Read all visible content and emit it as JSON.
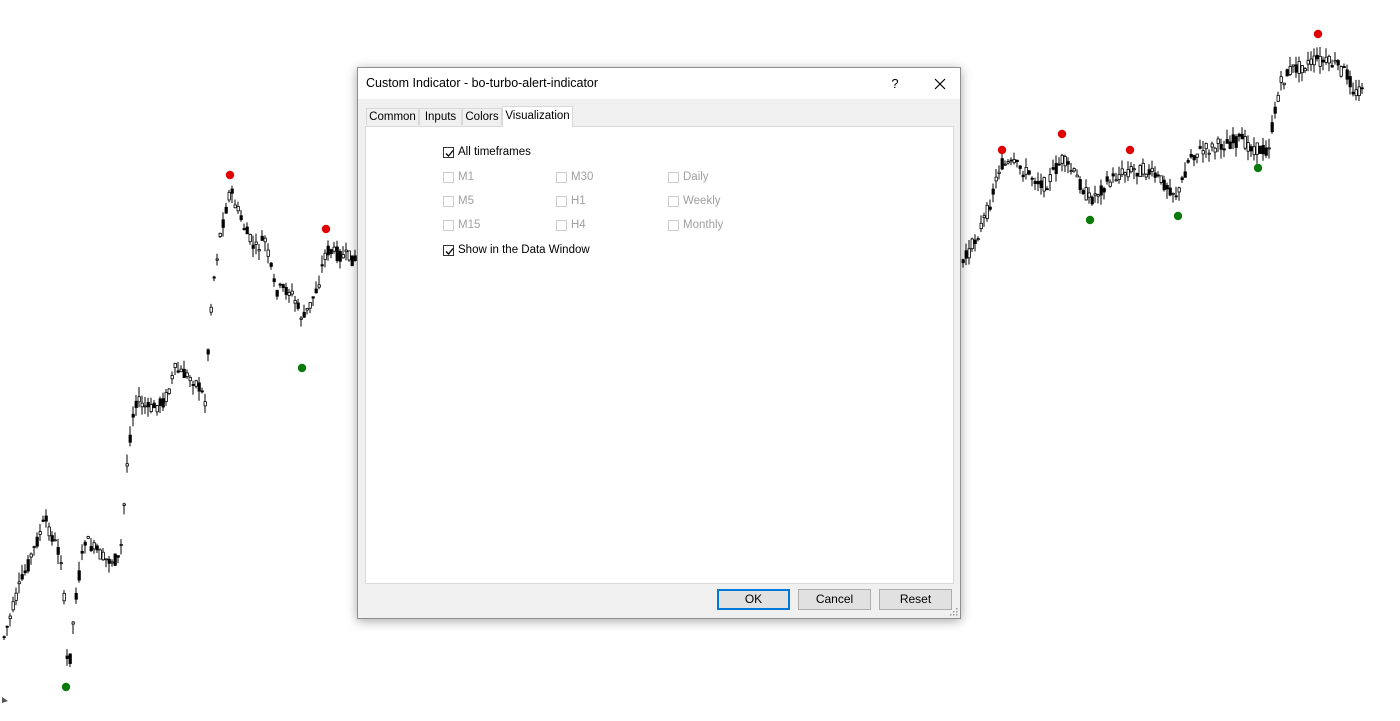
{
  "dialog": {
    "title": "Custom Indicator - bo-turbo-alert-indicator",
    "help_label": "?",
    "tabs": [
      {
        "label": "Common"
      },
      {
        "label": "Inputs"
      },
      {
        "label": "Colors"
      },
      {
        "label": "Visualization",
        "active": true
      }
    ],
    "visualization": {
      "all_timeframes": {
        "label": "All timeframes",
        "checked": true
      },
      "timeframes": [
        {
          "label": "M1",
          "checked": false
        },
        {
          "label": "M5",
          "checked": false
        },
        {
          "label": "M15",
          "checked": false
        },
        {
          "label": "M30",
          "checked": false
        },
        {
          "label": "H1",
          "checked": false
        },
        {
          "label": "H4",
          "checked": false
        },
        {
          "label": "Daily",
          "checked": false
        },
        {
          "label": "Weekly",
          "checked": false
        },
        {
          "label": "Monthly",
          "checked": false
        }
      ],
      "show_data_window": {
        "label": "Show in the Data Window",
        "checked": true
      }
    },
    "buttons": {
      "ok": "OK",
      "cancel": "Cancel",
      "reset": "Reset"
    }
  },
  "chart": {
    "candle_color": "#000000",
    "sell_marker_color": "#e00000",
    "buy_marker_color": "#0a7a0a"
  }
}
